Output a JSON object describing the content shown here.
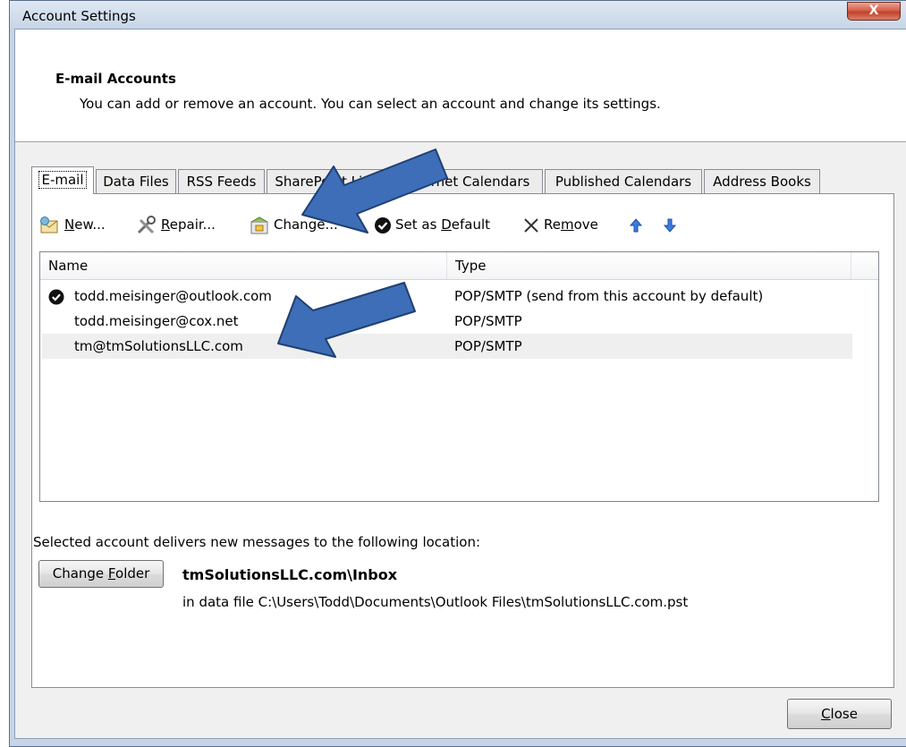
{
  "window": {
    "title": "Account Settings",
    "close_glyph": "X"
  },
  "header": {
    "title": "E-mail Accounts",
    "subtitle": "You can add or remove an account. You can select an account and change its settings."
  },
  "tabs": [
    {
      "label": "E-mail",
      "active": true
    },
    {
      "label": "Data Files"
    },
    {
      "label": "RSS Feeds"
    },
    {
      "label": "SharePoint Lists"
    },
    {
      "label": "Internet Calendars"
    },
    {
      "label": "Published Calendars"
    },
    {
      "label": "Address Books"
    }
  ],
  "toolbar": {
    "new_pre": "",
    "new_key": "N",
    "new_post": "ew...",
    "repair_pre": "",
    "repair_key": "R",
    "repair_post": "epair...",
    "change_pre": "Chan",
    "change_key": "g",
    "change_post": "e...",
    "default_pre": "Set as ",
    "default_key": "D",
    "default_post": "efault",
    "remove_pre": "Re",
    "remove_key": "m",
    "remove_post": "ove",
    "icons": {
      "new": "new-mail-icon",
      "repair": "repair-tools-icon",
      "change": "change-settings-icon",
      "default": "default-check-icon",
      "remove": "remove-x-icon",
      "up": "move-up-arrow-icon",
      "down": "move-down-arrow-icon"
    }
  },
  "accounts": {
    "columns": {
      "name": "Name",
      "type": "Type"
    },
    "rows": [
      {
        "name": "todd.meisinger@outlook.com",
        "type": "POP/SMTP (send from this account by default)",
        "default": true
      },
      {
        "name": "todd.meisinger@cox.net",
        "type": "POP/SMTP"
      },
      {
        "name": "tm@tmSolutionsLLC.com",
        "type": "POP/SMTP",
        "selected": true
      }
    ]
  },
  "delivery": {
    "label": "Selected account delivers new messages to the following location:",
    "button_pre": "Change ",
    "button_key": "F",
    "button_post": "older",
    "folder": "tmSolutionsLLC.com\\Inbox",
    "path": "in data file C:\\Users\\Todd\\Documents\\Outlook Files\\tmSolutionsLLC.com.pst"
  },
  "footer": {
    "close_key": "C",
    "close_post": "lose"
  },
  "colors": {
    "annotation_arrow": "#3d6eb7",
    "arrow_outline": "#203f73",
    "window_frame": "#c6d4e6",
    "selected_row": "#efefef"
  }
}
